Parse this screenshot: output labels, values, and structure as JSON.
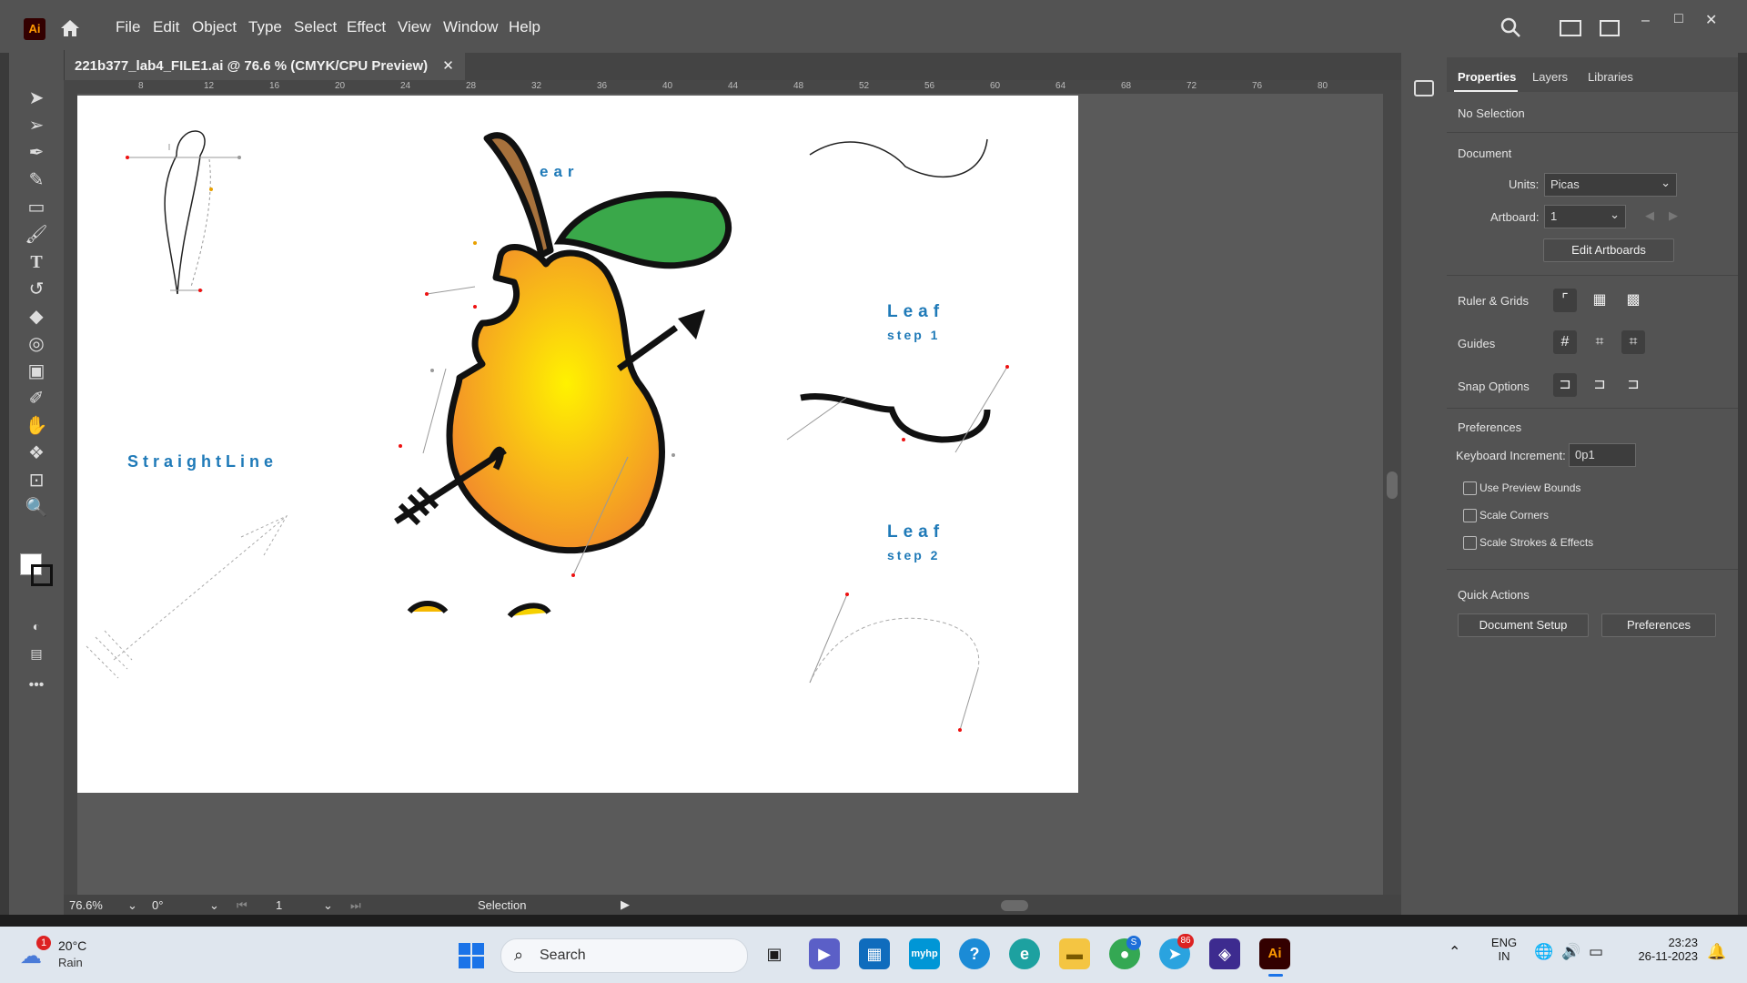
{
  "app": {
    "logo": "Ai",
    "home_icon": "home-icon"
  },
  "menu": [
    "File",
    "Edit",
    "Object",
    "Type",
    "Select",
    "Effect",
    "View",
    "Window",
    "Help"
  ],
  "window_controls": {
    "minimize": "–",
    "maximize": "□",
    "close": "✕"
  },
  "document_tab": {
    "title": "221b377_lab4_FILE1.ai @ 76.6 % (CMYK/CPU Preview)",
    "close": "✕"
  },
  "ruler_top_marks": [
    "8",
    "12",
    "16",
    "20",
    "24",
    "28",
    "32",
    "36",
    "40",
    "44",
    "48",
    "52",
    "56",
    "60",
    "64",
    "68",
    "72",
    "76",
    "80"
  ],
  "artboard_text": {
    "pear_title": "ear",
    "straight_line": "StraightLine",
    "leaf1_title": "Leaf",
    "leaf1_step": "step 1",
    "leaf2_title": "Leaf",
    "leaf2_step": "step 2"
  },
  "status_bar": {
    "zoom": "76.6%",
    "rotation": "0°",
    "artboard": "1",
    "mode": "Selection"
  },
  "panel": {
    "tabs": [
      "Properties",
      "Layers",
      "Libraries"
    ],
    "selection": "No Selection",
    "document_header": "Document",
    "units_label": "Units:",
    "units_value": "Picas",
    "artboard_label": "Artboard:",
    "artboard_value": "1",
    "edit_artboards": "Edit Artboards",
    "ruler_grids": "Ruler & Grids",
    "guides": "Guides",
    "snap_options": "Snap Options",
    "preferences_header": "Preferences",
    "keyboard_increment_label": "Keyboard Increment:",
    "keyboard_increment_value": "0p1",
    "checkboxes": [
      "Use Preview Bounds",
      "Scale Corners",
      "Scale Strokes & Effects"
    ],
    "quick_actions": "Quick Actions",
    "document_setup": "Document Setup",
    "preferences_btn": "Preferences"
  },
  "taskbar": {
    "weather_temp": "20°C",
    "weather_desc": "Rain",
    "weather_badge": "1",
    "search_placeholder": "Search",
    "lang_top": "ENG",
    "lang_bottom": "IN",
    "time": "23:23",
    "date": "26-11-2023",
    "telegram_badge": "86",
    "skype_badge": "S"
  },
  "colors": {
    "accent": "#1473e6",
    "pear_title": "#1f7ab8",
    "leaf_green": "#3aa84a"
  }
}
